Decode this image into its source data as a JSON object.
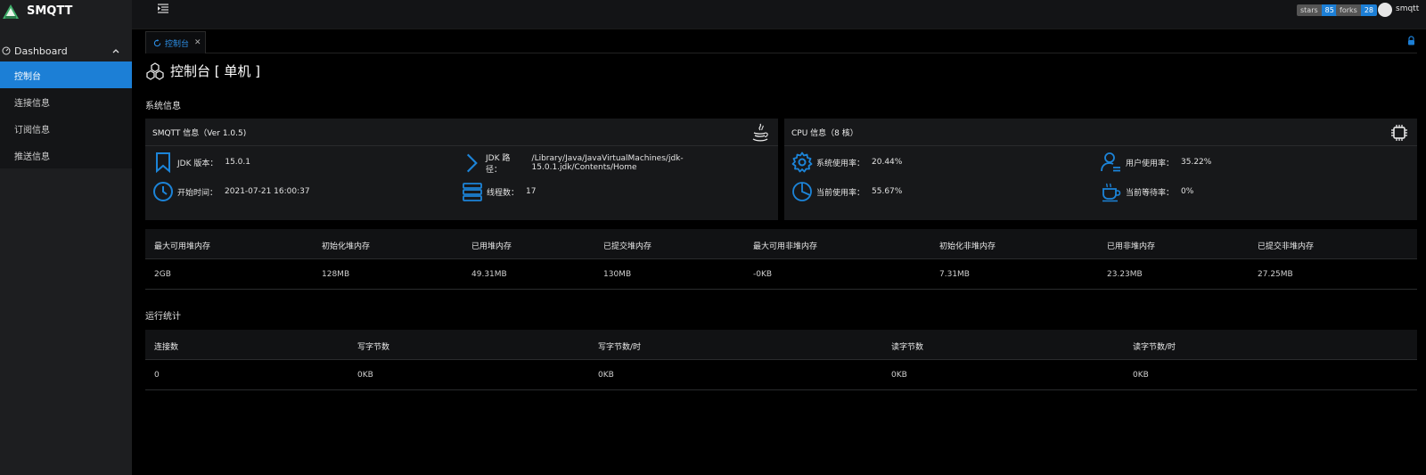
{
  "app": {
    "name": "SMQTT"
  },
  "sidebar": {
    "group_label": "Dashboard",
    "items": [
      {
        "label": "控制台",
        "active": true
      },
      {
        "label": "连接信息"
      },
      {
        "label": "订阅信息"
      },
      {
        "label": "推送信息"
      }
    ]
  },
  "header": {
    "stars_label": "stars",
    "stars_count": "85",
    "forks_label": "forks",
    "forks_count": "28",
    "user_name": "smqtt"
  },
  "tabs": [
    {
      "label": "控制台"
    }
  ],
  "page": {
    "title": "控制台 [ 单机 ]"
  },
  "system_info": {
    "section_title": "系统信息",
    "smqtt_card": {
      "title": "SMQTT 信息（Ver 1.0.5)",
      "jdk_version_label": "JDK 版本：",
      "jdk_version": "15.0.1",
      "jdk_path_label": "JDK 路径：",
      "jdk_path": "/Library/Java/JavaVirtualMachines/jdk-15.0.1.jdk/Contents/Home",
      "start_time_label": "开始时间：",
      "start_time": "2021-07-21 16:00:37",
      "threads_label": "线程数：",
      "threads": "17"
    },
    "cpu_card": {
      "title": "CPU 信息（8 核）",
      "system_usage_label": "系统使用率：",
      "system_usage": "20.44%",
      "user_usage_label": "用户使用率：",
      "user_usage": "35.22%",
      "current_usage_label": "当前使用率：",
      "current_usage": "55.67%",
      "current_wait_label": "当前等待率：",
      "current_wait": "0%"
    }
  },
  "memory_table": {
    "headers": [
      "最大可用堆内存",
      "初始化堆内存",
      "已用堆内存",
      "已提交堆内存",
      "最大可用非堆内存",
      "初始化非堆内存",
      "已用非堆内存",
      "已提交非堆内存"
    ],
    "row": [
      "2GB",
      "128MB",
      "49.31MB",
      "130MB",
      "-0KB",
      "7.31MB",
      "23.23MB",
      "27.25MB"
    ]
  },
  "runtime_stats": {
    "section_title": "运行统计",
    "headers": [
      "连接数",
      "写字节数",
      "写字节数/时",
      "读字节数",
      "读字节数/时"
    ],
    "row": [
      "0",
      "0KB",
      "0KB",
      "0KB",
      "0KB"
    ]
  },
  "colors": {
    "accent": "#1c7fd6",
    "icon_blue": "#1c84d8",
    "sidebar_bg": "#1d1e20",
    "card_bg": "#17181a"
  }
}
